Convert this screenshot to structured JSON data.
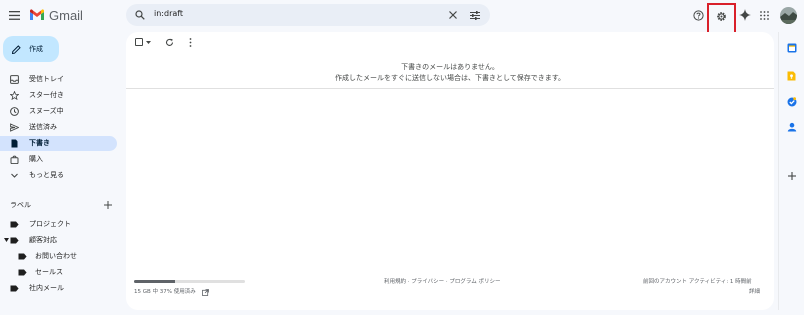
{
  "header": {
    "app_name": "Gmail",
    "search_value": "in:draft"
  },
  "compose": {
    "label": "作成"
  },
  "sidebar": {
    "items": [
      {
        "label": "受信トレイ",
        "icon": "inbox-icon"
      },
      {
        "label": "スター付き",
        "icon": "star-icon"
      },
      {
        "label": "スヌーズ中",
        "icon": "clock-icon"
      },
      {
        "label": "送信済み",
        "icon": "send-icon"
      },
      {
        "label": "下書き",
        "icon": "draft-icon",
        "active": true
      },
      {
        "label": "購入",
        "icon": "shopping-bag-icon"
      },
      {
        "label": "もっと見る",
        "icon": "chevron-down-icon"
      }
    ],
    "labels_title": "ラベル",
    "labels": [
      {
        "label": "プロジェクト"
      },
      {
        "label": "顧客対応"
      },
      {
        "label": "お問い合わせ"
      },
      {
        "label": "セールス"
      },
      {
        "label": "社内メール"
      }
    ]
  },
  "main": {
    "empty_line_1": "下書きのメールはありません。",
    "empty_line_2": "作成したメールをすぐに送信しない場合は、下書きとして保存できます。"
  },
  "footer": {
    "storage_text": "15 GB 中 37% 使用済み",
    "storage_fraction": 0.37,
    "links": "利用規約 · プライバシー · プログラム ポリシー",
    "activity": "前回のアカウント アクティビティ: 1 時間前",
    "details": "詳細"
  },
  "colors": {
    "accent": "#0b57d0",
    "highlight": "#d9202a",
    "compose_bg": "#c2e7ff",
    "active_nav_bg": "#d3e3fd"
  }
}
